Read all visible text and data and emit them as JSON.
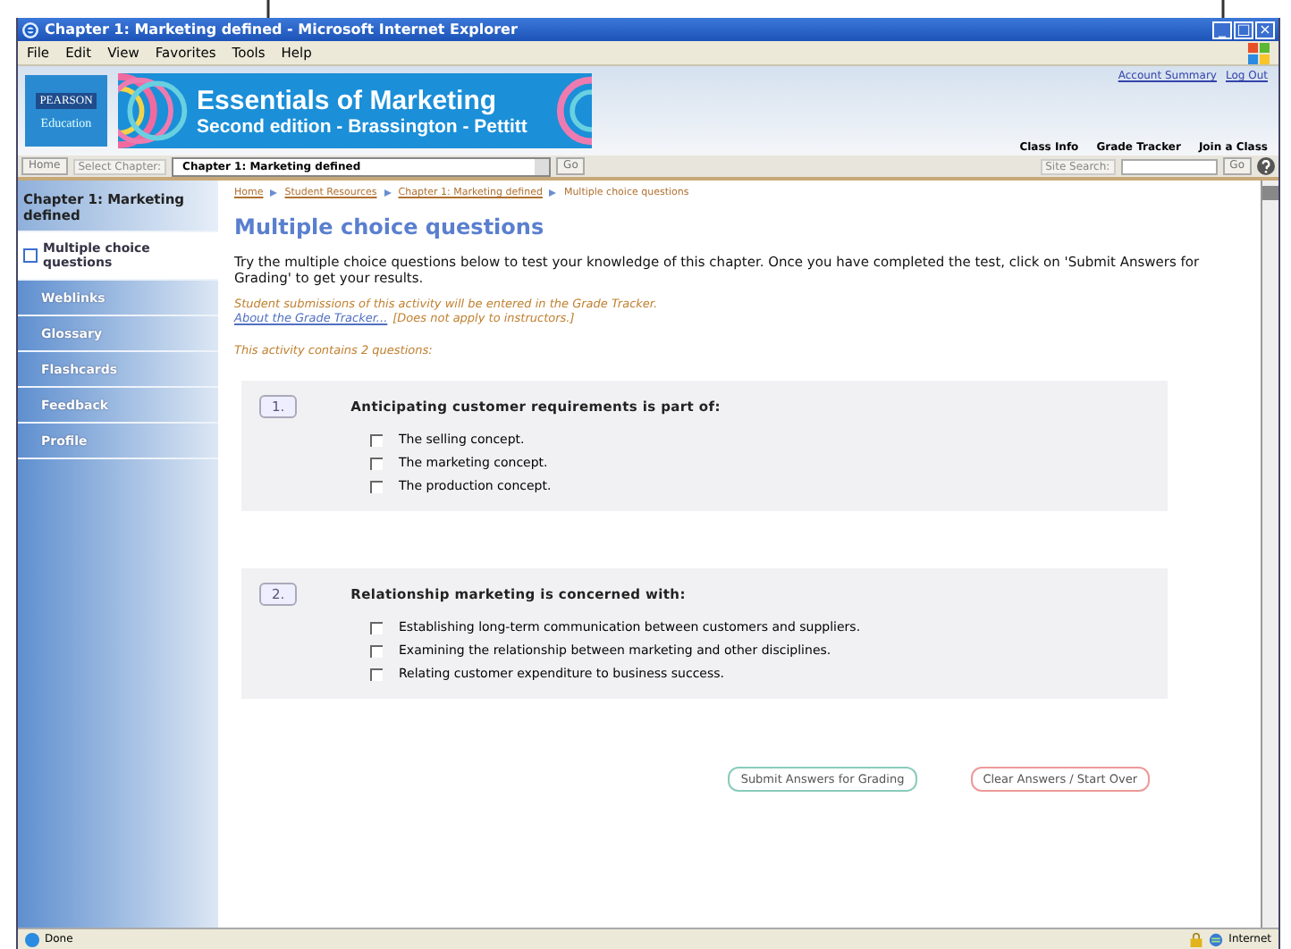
{
  "window": {
    "title": "Chapter 1: Marketing defined - Microsoft Internet Explorer",
    "controls": [
      "_",
      "□",
      "×"
    ]
  },
  "menu": [
    "File",
    "Edit",
    "View",
    "Favorites",
    "Tools",
    "Help"
  ],
  "header": {
    "logo_top": "PEARSON",
    "logo_bottom": "Education",
    "title": "Essentials of Marketing",
    "subtitle": "Second edition - Brassington - Pettitt",
    "account_links": [
      "Account Summary",
      "Log Out"
    ],
    "nav_links": [
      "Class Info",
      "Grade Tracker",
      "Join a Class"
    ]
  },
  "toolbar": {
    "home": "Home",
    "select_label": "Select Chapter:",
    "chapter": "Chapter 1: Marketing defined",
    "go": "Go",
    "search_label": "Site Search:",
    "search_go": "Go"
  },
  "sidebar": {
    "heading": "Chapter 1: Marketing defined",
    "items": [
      {
        "label": "Multiple choice questions",
        "selected": true
      },
      {
        "label": "Weblinks",
        "selected": false
      },
      {
        "label": "Glossary",
        "selected": false
      },
      {
        "label": "Flashcards",
        "selected": false
      },
      {
        "label": "Feedback",
        "selected": false
      },
      {
        "label": "Profile",
        "selected": false
      }
    ]
  },
  "breadcrumb": [
    "Home",
    "Student Resources",
    "Chapter 1: Marketing defined",
    "Multiple choice questions"
  ],
  "page_title": "Multiple choice questions",
  "intro": "Try the multiple choice questions below to test your knowledge of this chapter. Once you have completed the test, click on 'Submit Answers for Grading' to get your results.",
  "notice": "Student submissions of this activity will be entered in the Grade Tracker.",
  "notice_link": "About the Grade Tracker...",
  "notice_tail": "[Does not apply to instructors.]",
  "count_note": "This activity contains 2 questions:",
  "questions": [
    {
      "number": "1.",
      "text": "Anticipating customer requirements is part of:",
      "options": [
        {
          "label": "The selling concept.",
          "selected": false
        },
        {
          "label": "The marketing concept.",
          "selected": false
        },
        {
          "label": "The production concept.",
          "selected": false
        }
      ]
    },
    {
      "number": "2.",
      "text": "Relationship marketing is concerned with:",
      "options": [
        {
          "label": "Establishing long-term communication between customers and suppliers.",
          "selected": false
        },
        {
          "label": "Examining the relationship between marketing and other disciplines.",
          "selected": false
        },
        {
          "label": "Relating customer expenditure to business success.",
          "selected": false
        }
      ]
    }
  ],
  "buttons": [
    "Submit Answers for Grading",
    "Clear Answers / Start Over"
  ],
  "status_bar": {
    "text": "Done",
    "zone": "Internet"
  }
}
